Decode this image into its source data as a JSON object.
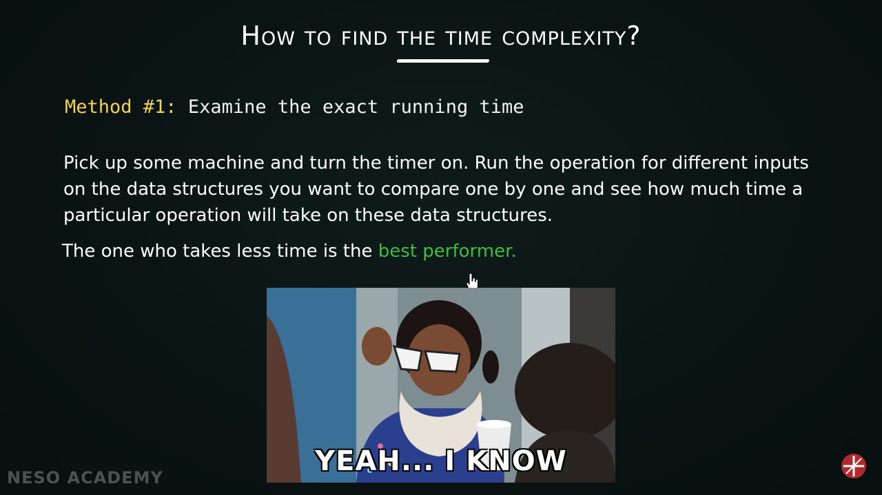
{
  "slide": {
    "title": "How to find the time complexity?",
    "method_label": "Method #1:",
    "method_text": " Examine the exact running time",
    "paragraph": "Pick up some machine and turn the timer on. Run the operation for different inputs on the data structures you want to compare one by one and see how much time a particular operation will take on these data structures.",
    "conclusion_prefix": "The one who takes less time is the ",
    "conclusion_highlight": "best performer."
  },
  "meme": {
    "caption": "YEAH... I KNOW"
  },
  "brand": {
    "name": "NESO ACADEMY",
    "logo_icon": "neso-logo-icon"
  },
  "colors": {
    "background": "#0b1414",
    "method_label": "#f3d34a",
    "highlight": "#3cbf3c",
    "text": "#ffffff"
  }
}
